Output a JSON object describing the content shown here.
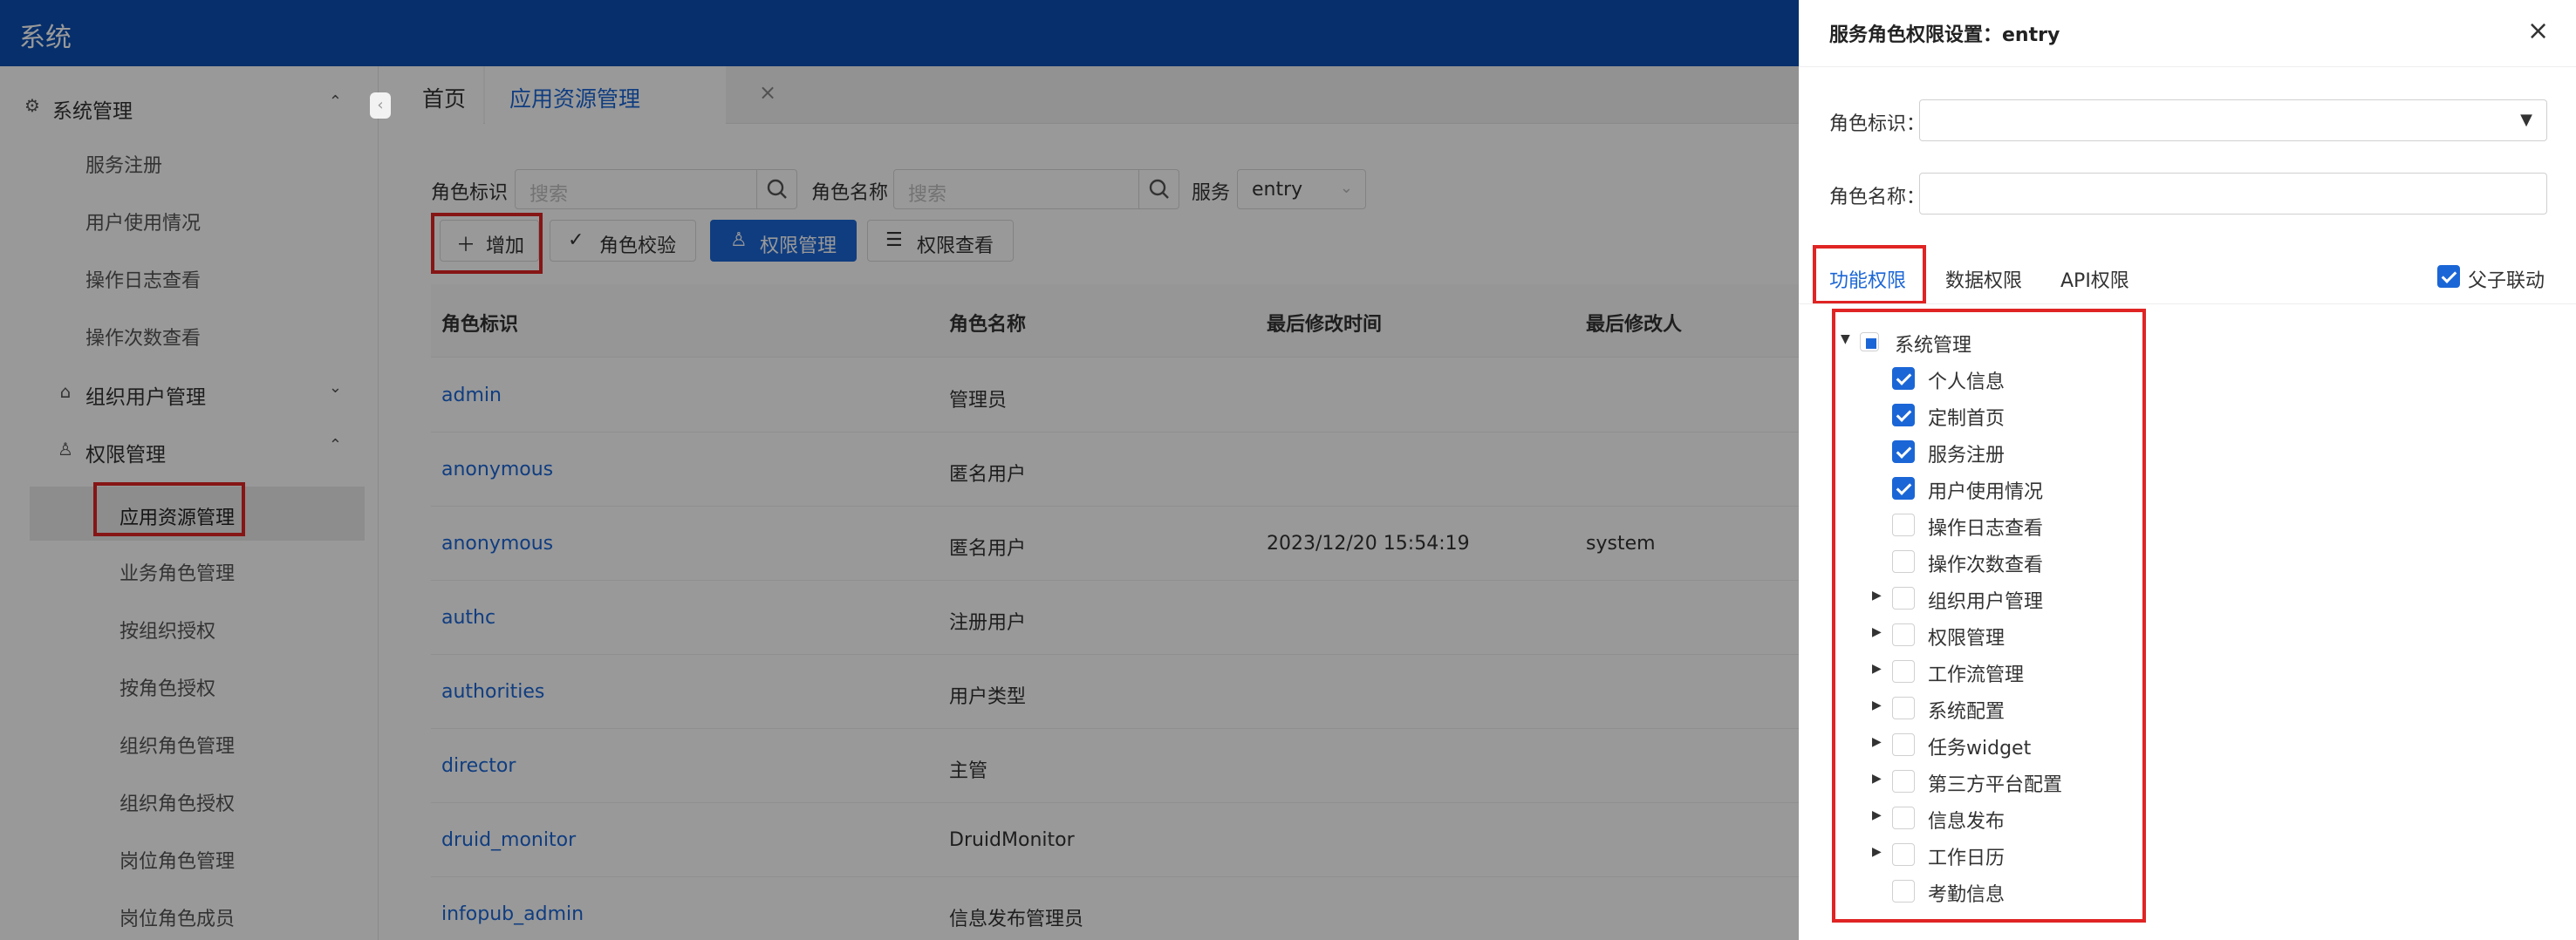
{
  "app": {
    "title": "系统"
  },
  "sidebar": {
    "groups": {
      "system": {
        "label": "系统管理",
        "icon": "gear-icon"
      },
      "org": {
        "label": "组织用户管理",
        "icon": "bank-icon"
      },
      "perm": {
        "label": "权限管理",
        "icon": "user-icon"
      }
    },
    "sys_items": [
      "服务注册",
      "用户使用情况",
      "操作日志查看",
      "操作次数查看"
    ],
    "perm_items": [
      "应用资源管理",
      "业务角色管理",
      "按组织授权",
      "按角色授权",
      "组织角色管理",
      "组织角色授权",
      "岗位角色管理",
      "岗位角色成员"
    ],
    "active_item": "应用资源管理"
  },
  "tabs": {
    "home": "首页",
    "app": "应用资源管理"
  },
  "filters": {
    "role_id_label": "角色标识",
    "role_id_placeholder": "搜索",
    "role_name_label": "角色名称",
    "role_name_placeholder": "搜索",
    "service_label": "服务",
    "service_value": "entry"
  },
  "toolbar": {
    "add": "增加",
    "check": "角色校验",
    "perm_manage": "权限管理",
    "perm_view": "权限查看"
  },
  "table": {
    "headers": [
      "角色标识",
      "角色名称",
      "最后修改时间",
      "最后修改人"
    ],
    "rows": [
      {
        "id": "admin",
        "name": "管理员",
        "time": "",
        "user": ""
      },
      {
        "id": "anonymous",
        "name": "匿名用户",
        "time": "",
        "user": ""
      },
      {
        "id": "anonymous",
        "name": "匿名用户",
        "time": "2023/12/20 15:54:19",
        "user": "system"
      },
      {
        "id": "authc",
        "name": "注册用户",
        "time": "",
        "user": ""
      },
      {
        "id": "authorities",
        "name": "用户类型",
        "time": "",
        "user": ""
      },
      {
        "id": "director",
        "name": "主管",
        "time": "",
        "user": ""
      },
      {
        "id": "druid_monitor",
        "name": "DruidMonitor",
        "time": "",
        "user": ""
      },
      {
        "id": "infopub_admin",
        "name": "信息发布管理员",
        "time": "",
        "user": ""
      }
    ]
  },
  "drawer": {
    "title": "服务角色权限设置：entry",
    "role_id_label": "角色标识：",
    "role_name_label": "角色名称：",
    "tabs": [
      "功能权限",
      "数据权限",
      "API权限"
    ],
    "active_tab": "功能权限",
    "link_label": "父子联动",
    "link_checked": true,
    "tree": {
      "root": "系统管理",
      "children": [
        {
          "label": "个人信息",
          "checked": true,
          "expandable": false
        },
        {
          "label": "定制首页",
          "checked": true,
          "expandable": false
        },
        {
          "label": "服务注册",
          "checked": true,
          "expandable": false
        },
        {
          "label": "用户使用情况",
          "checked": true,
          "expandable": false
        },
        {
          "label": "操作日志查看",
          "checked": false,
          "expandable": false
        },
        {
          "label": "操作次数查看",
          "checked": false,
          "expandable": false
        },
        {
          "label": "组织用户管理",
          "checked": false,
          "expandable": true
        },
        {
          "label": "权限管理",
          "checked": false,
          "expandable": true
        },
        {
          "label": "工作流管理",
          "checked": false,
          "expandable": true
        },
        {
          "label": "系统配置",
          "checked": false,
          "expandable": true
        },
        {
          "label": "任务widget",
          "checked": false,
          "expandable": true
        },
        {
          "label": "第三方平台配置",
          "checked": false,
          "expandable": true
        },
        {
          "label": "信息发布",
          "checked": false,
          "expandable": true
        },
        {
          "label": "工作日历",
          "checked": false,
          "expandable": true
        },
        {
          "label": "考勤信息",
          "checked": false,
          "expandable": false
        }
      ]
    }
  },
  "colors": {
    "primary": "#1b66d6",
    "topbar": "#0a4fb3",
    "highlight": "#e02424"
  }
}
